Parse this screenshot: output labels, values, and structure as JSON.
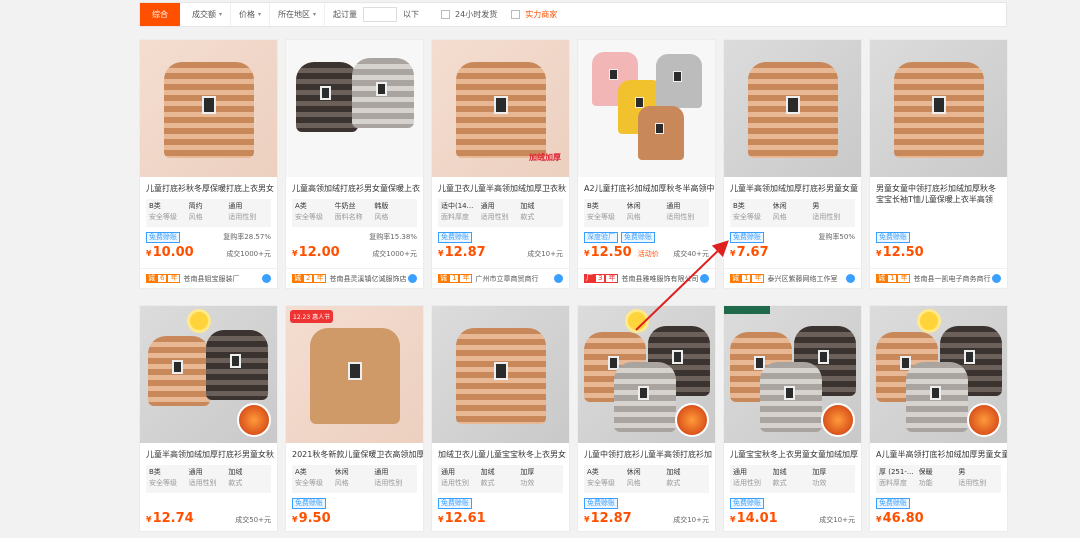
{
  "filterbar": {
    "active": "综合",
    "items": [
      "成交额",
      "价格",
      "所在地区"
    ],
    "moq_label": "起订量",
    "below": "以下",
    "check1": "24小时发货",
    "check2": "实力商家"
  },
  "row1": [
    {
      "title": "儿童打底衫秋冬厚保暖打底上衣男女",
      "attrs": [
        [
          "B类",
          "安全等级"
        ],
        [
          "简约",
          "风格"
        ],
        [
          "通用",
          "适用性别"
        ]
      ],
      "tags": [
        "免费赊账"
      ],
      "rate": "复购率28.57%",
      "price": "10.00",
      "promo": "",
      "deals": "成交1000+元",
      "years": "6",
      "shop": "苍南县姐宝服装厂"
    },
    {
      "title": "儿童高领加绒打底衫男女童保暖上衣",
      "attrs": [
        [
          "A类",
          "安全等级"
        ],
        [
          "牛奶丝",
          "面料名称"
        ],
        [
          "韩版",
          "风格"
        ]
      ],
      "tags": [],
      "rate": "复购率15.38%",
      "price": "12.00",
      "promo": "",
      "deals": "成交1000+元",
      "years": "2",
      "shop": "苍南县灵溪镇亿诚服饰店"
    },
    {
      "title": "儿童卫衣儿童半高领加绒加厚卫衣秋",
      "attrs": [
        [
          "适中(14...",
          "面料厚度"
        ],
        [
          "通用",
          "适用性别"
        ],
        [
          "加绒",
          "款式"
        ]
      ],
      "tags": [
        "免费赊账"
      ],
      "rate": "",
      "price": "12.87",
      "promo": "",
      "deals": "成交10+元",
      "years": "1",
      "shop": "广州市立章商贸商行"
    },
    {
      "title": "A2儿童打底衫加绒加厚秋冬半高领中",
      "attrs": [
        [
          "B类",
          "安全等级"
        ],
        [
          "休闲",
          "风格"
        ],
        [
          "通用",
          "适用性别"
        ]
      ],
      "tags": [
        "深度验厂",
        "免费赊账"
      ],
      "rate": "",
      "price": "12.50",
      "promo": "活动价",
      "deals": "成交40+元",
      "years": "3",
      "shop": "苍南县雅唯服饰有限公司"
    },
    {
      "title": "儿童半高领加绒加厚打底衫男童女童",
      "attrs": [
        [
          "B类",
          "安全等级"
        ],
        [
          "休闲",
          "风格"
        ],
        [
          "男",
          "适用性别"
        ]
      ],
      "tags": [
        "免费赊账"
      ],
      "rate": "复购率50%",
      "price": "7.67",
      "promo": "",
      "deals": "",
      "years": "1",
      "shop": "泰兴区紫藤网络工作室"
    },
    {
      "title": "男童女童中领打底衫加绒加厚秋冬宝宝长袖T恤儿童保暖上衣半高领",
      "attrs": [],
      "tags": [
        "免费赊账"
      ],
      "rate": "",
      "price": "12.50",
      "promo": "",
      "deals": "",
      "years": "1",
      "shop": "苍南县一凯电子商务商行"
    }
  ],
  "row2": [
    {
      "title": "儿童半高领加绒加厚打底衫男童女秋",
      "attrs": [
        [
          "B类",
          "安全等级"
        ],
        [
          "通用",
          "适用性别"
        ],
        [
          "加绒",
          "款式"
        ]
      ],
      "tags": [],
      "rate": "",
      "price": "12.74",
      "promo": "",
      "deals": "成交50+元"
    },
    {
      "title": "2021秋冬新款儿童保暖卫衣高领加厚",
      "attrs": [
        [
          "A类",
          "安全等级"
        ],
        [
          "休闲",
          "风格"
        ],
        [
          "通用",
          "适用性别"
        ]
      ],
      "tags": [
        "免费赊账"
      ],
      "rate": "",
      "price": "9.50",
      "promo": "",
      "deals": "",
      "imgtag": "12.23 惠人节"
    },
    {
      "title": "加绒卫衣儿童儿童宝宝秋冬上衣男女",
      "attrs": [
        [
          "通用",
          "适用性别"
        ],
        [
          "加绒",
          "款式"
        ],
        [
          "加厚",
          "功效"
        ]
      ],
      "tags": [
        "免费赊账"
      ],
      "rate": "",
      "price": "12.61",
      "promo": "",
      "deals": ""
    },
    {
      "title": "儿童中领打底衫儿童半高领打底衫加",
      "attrs": [
        [
          "A类",
          "安全等级"
        ],
        [
          "休闲",
          "风格"
        ],
        [
          "加绒",
          "款式"
        ]
      ],
      "tags": [
        "免费赊账"
      ],
      "rate": "",
      "price": "12.87",
      "promo": "",
      "deals": "成交10+元"
    },
    {
      "title": "儿童宝宝秋冬上衣男童女童加绒加厚",
      "attrs": [
        [
          "通用",
          "适用性别"
        ],
        [
          "加绒",
          "款式"
        ],
        [
          "加厚",
          "功效"
        ]
      ],
      "tags": [
        "免费赊账"
      ],
      "rate": "",
      "price": "14.01",
      "promo": "",
      "deals": "成交10+元"
    },
    {
      "title": "A儿童半高领打底衫加绒加厚男童女童",
      "attrs": [
        [
          "厚 (251-...",
          "面料厚度"
        ],
        [
          "保暖",
          "功能"
        ],
        [
          "男",
          "适用性别"
        ]
      ],
      "tags": [
        "免费赊账"
      ],
      "rate": "",
      "price": "46.80",
      "promo": "",
      "deals": ""
    }
  ],
  "currency": "¥",
  "image_overlay_text": "加绒加厚",
  "colors": {
    "accent": "#ff5000",
    "tag_blue": "#3aa0ff",
    "arrow": "#e02020"
  }
}
